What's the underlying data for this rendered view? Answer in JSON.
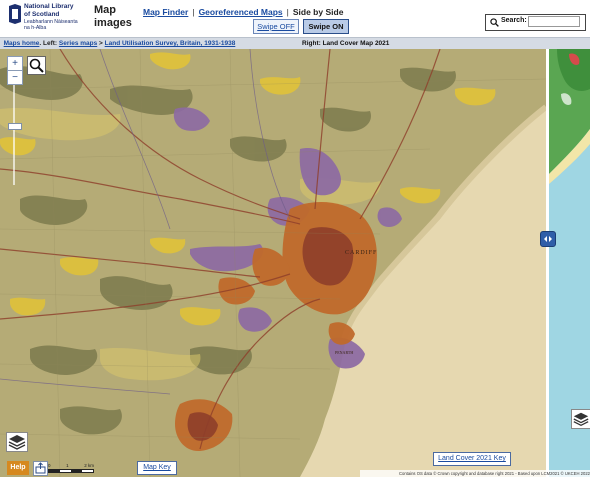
{
  "header": {
    "logo_line1": "National Library",
    "logo_line2": "of Scotland",
    "logo_line3": "Leabharlann Nàiseanta",
    "logo_line4": "na h-Alba",
    "site_title": "Map images",
    "nav": {
      "map_finder": "Map Finder",
      "georeferenced": "Georeferenced Maps",
      "side_by_side": "Side by Side",
      "separator": "|"
    },
    "swipe_off": "Swipe OFF",
    "swipe_on": "Swipe ON",
    "search": {
      "label": "Search:",
      "value": "",
      "placeholder": ""
    }
  },
  "breadcrumb": {
    "maps_home": "Maps home",
    "dot": ".",
    "left_label": "Left:",
    "series_maps": "Series maps",
    "arrow": ">",
    "survey": "Land Utilisation Survey, Britain, 1931-1938",
    "right_label": "Right: Land Cover Map 2021"
  },
  "map": {
    "zoom_in": "+",
    "zoom_out": "−",
    "zoom_level_fraction": 0.6,
    "place_label": "CARDIFF",
    "place_label2": "PENARTH",
    "help": "Help",
    "scale_labels": [
      "0",
      "1",
      "2 km"
    ],
    "map_key": "Map Key",
    "land_cover_key": "Land Cover 2021 Key",
    "attribution": "Contains OS data © Crown copyright and database right 2021 - Based upon LCM2021 © UKCEH 2022"
  },
  "colors": {
    "grassland": "#b5ab76",
    "arable": "#d9c66b",
    "heath": "#e0c23a",
    "woodland": "#7c7a4d",
    "urban": "#c06a2c",
    "urban_dark": "#8e3e2a",
    "housing": "#8d6aa3",
    "sand": "#e6d8b0",
    "lcm_green": "#5aa652",
    "lcm_blue": "#9fd6e3",
    "link": "#1a4ba0"
  }
}
